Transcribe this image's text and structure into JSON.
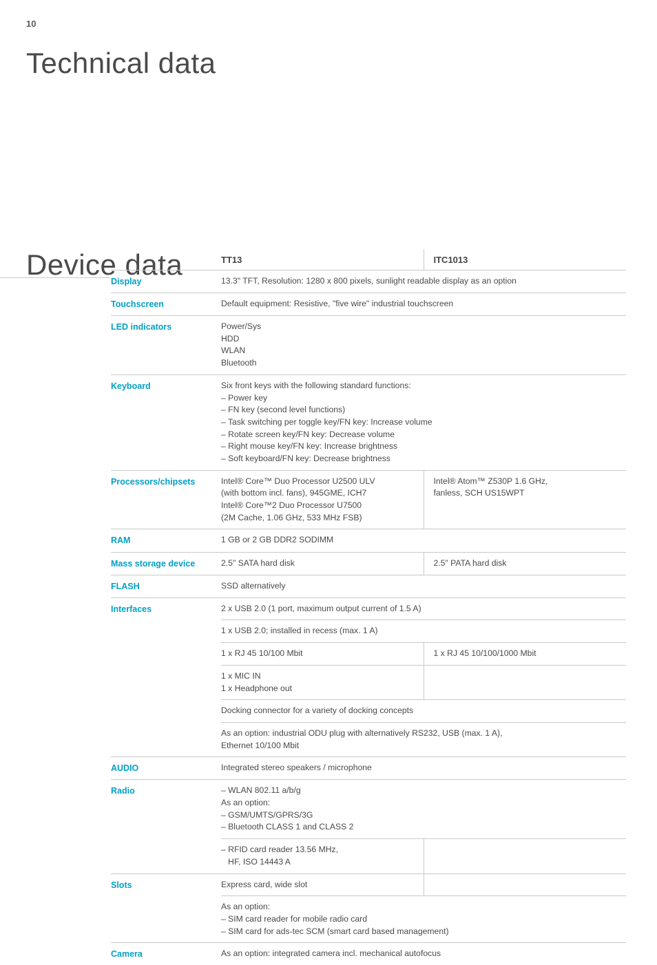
{
  "page_number": "10",
  "heading_main": "Technical data",
  "heading_section": "Device data",
  "cols": {
    "tt13": "TT13",
    "itc1013": "ITC1013"
  },
  "rows": {
    "display": {
      "label": "Display",
      "val": "13.3\" TFT, Resolution: 1280 x 800 pixels, sunlight readable display as an option"
    },
    "touchscreen": {
      "label": "Touchscreen",
      "val": "Default equipment: Resistive, \"five wire\" industrial touchscreen"
    },
    "led": {
      "label": "LED indicators",
      "lines": [
        "Power/Sys",
        "HDD",
        "WLAN",
        "Bluetooth"
      ]
    },
    "keyboard": {
      "label": "Keyboard",
      "lines": [
        "Six front keys with the following standard functions:",
        "– Power key",
        "– FN key (second level functions)",
        "– Task switching per toggle key/FN key: Increase volume",
        "– Rotate screen key/FN key: Decrease volume",
        "– Right mouse key/FN key: Increase brightness",
        "– Soft keyboard/FN key: Decrease brightness"
      ]
    },
    "proc": {
      "label": "Processors/chipsets",
      "left_lines": [
        "Intel® Core™ Duo Processor U2500 ULV",
        "(with bottom incl. fans), 945GME, ICH7",
        "Intel® Core™2 Duo Processor U7500",
        "(2M Cache, 1.06 GHz, 533 MHz FSB)"
      ],
      "right_lines": [
        "Intel® Atom™ Z530P 1.6 GHz,",
        "fanless, SCH US15WPT"
      ]
    },
    "ram": {
      "label": "RAM",
      "val": "1 GB or 2 GB DDR2 SODIMM"
    },
    "mass": {
      "label": "Mass storage device",
      "left": "2.5\" SATA hard disk",
      "right": "2.5\" PATA hard disk"
    },
    "flash": {
      "label": "FLASH",
      "val": "SSD alternatively"
    },
    "interfaces": {
      "label": "Interfaces",
      "r1": "2 x USB 2.0 (1 port, maximum output current of 1.5 A)",
      "r2": "1 x USB 2.0; installed in recess (max. 1 A)",
      "r3l": "1 x RJ 45 10/100 Mbit",
      "r3r": "1 x RJ 45 10/100/1000 Mbit",
      "r4_lines": [
        "1 x MIC IN",
        "1 x Headphone out"
      ],
      "r5": "Docking connector for a variety of docking concepts",
      "r6_lines": [
        "As an option: industrial ODU plug with alternatively RS232, USB (max. 1 A),",
        "Ethernet 10/100 Mbit"
      ]
    },
    "audio": {
      "label": "AUDIO",
      "val": "Integrated stereo speakers / microphone"
    },
    "radio": {
      "label": "Radio",
      "r1_lines": [
        "– WLAN 802.11 a/b/g",
        "As an option:",
        "– GSM/UMTS/GPRS/3G",
        "– Bluetooth CLASS 1 and CLASS 2"
      ],
      "r2_lines": [
        "– RFID card reader 13.56 MHz,",
        "   HF, ISO 14443 A"
      ]
    },
    "slots": {
      "label": "Slots",
      "r1": "Express card, wide slot",
      "r2_lines": [
        "As an option:",
        "– SIM card reader for mobile radio card",
        "– SIM card for ads-tec SCM (smart card based management)"
      ]
    },
    "camera": {
      "label": "Camera",
      "val": "As an option: integrated camera incl. mechanical autofocus"
    }
  }
}
